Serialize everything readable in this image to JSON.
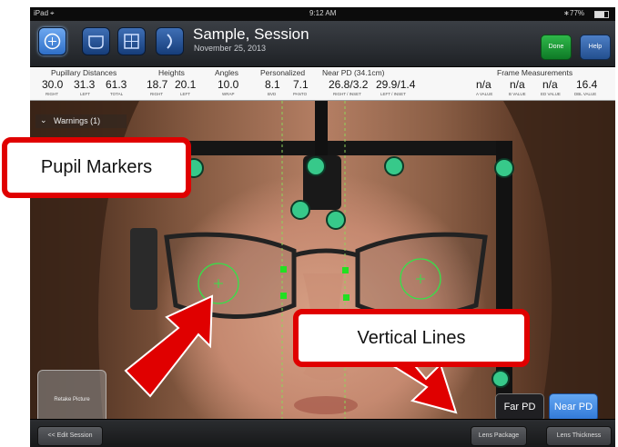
{
  "status_bar": {
    "device": "iPad",
    "time": "9:12 AM",
    "battery": "77%"
  },
  "header": {
    "title": "Sample, Session",
    "date": "November 25, 2013",
    "done_label": "Done",
    "help_label": "Help"
  },
  "measurements": {
    "groups": {
      "pupillary": "Pupillary Distances",
      "heights": "Heights",
      "angles": "Angles",
      "personalized": "Personalized",
      "near_pd": "Near PD (34.1cm)",
      "frame": "Frame Measurements"
    },
    "items": [
      {
        "value": "30.0",
        "label": "RIGHT"
      },
      {
        "value": "31.3",
        "label": "LEFT"
      },
      {
        "value": "61.3",
        "label": "TOTAL"
      },
      {
        "value": "18.7",
        "label": "RIGHT"
      },
      {
        "value": "20.1",
        "label": "LEFT"
      },
      {
        "value": "10.0",
        "label": "WRAP"
      },
      {
        "value": "8.1",
        "label": "BVD"
      },
      {
        "value": "7.1",
        "label": "PANTO"
      },
      {
        "value": "26.8/3.2",
        "label": "RIGHT / INSET"
      },
      {
        "value": "29.9/1.4",
        "label": "LEFT / INSET"
      },
      {
        "value": "n/a",
        "label": "A VALUE"
      },
      {
        "value": "n/a",
        "label": "B VALUE"
      },
      {
        "value": "n/a",
        "label": "ED VALUE"
      },
      {
        "value": "16.4",
        "label": "DBL VALUE"
      }
    ]
  },
  "warnings_label": "Warnings (1)",
  "retake_label": "Retake Picture",
  "pd_toggle": {
    "far": "Far PD",
    "near": "Near PD"
  },
  "bottom_bar": {
    "edit_session": "<< Edit Session",
    "lens_package": "Lens Package",
    "lens_thickness": "Lens Thickness"
  },
  "callouts": {
    "pupil_markers": "Pupil Markers",
    "vertical_lines": "Vertical Lines"
  },
  "colors": {
    "marker_green": "#37c98a",
    "pd_line_green": "#8fd45a",
    "square_handle": "#22e022",
    "callout_red": "#e00000",
    "near_pd_blue": "#4a90e2"
  }
}
